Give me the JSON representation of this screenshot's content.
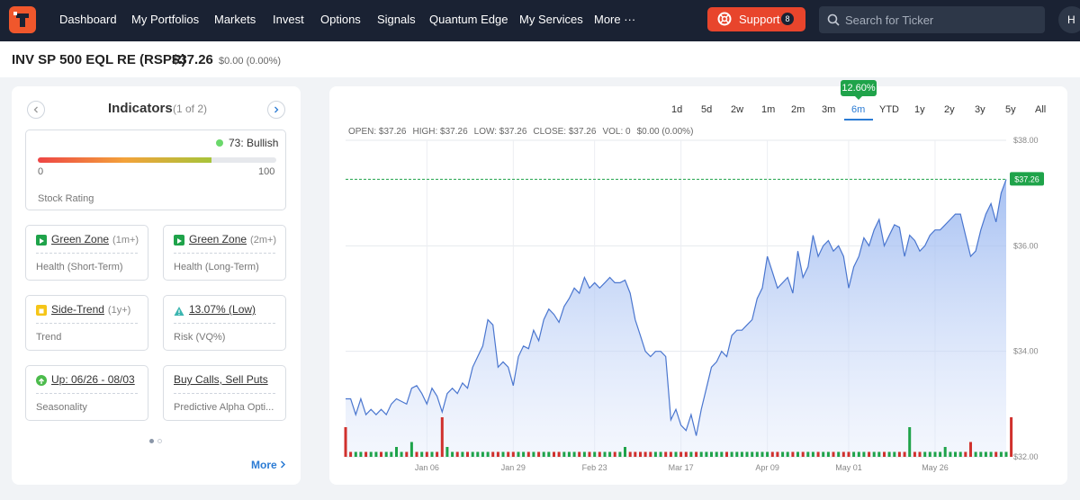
{
  "nav": {
    "items": [
      "Dashboard",
      "My Portfolios",
      "Markets",
      "Invest",
      "Options",
      "Signals",
      "Quantum Edge",
      "My Services",
      "More ···"
    ],
    "support_label": "Support",
    "support_count": "8",
    "search_placeholder": "Search for Ticker",
    "avatar_initial": "H"
  },
  "ticker": {
    "name": "INV SP 500 EQL RE (RSPR)",
    "price": "$37.26",
    "change": "$0.00 (0.00%)"
  },
  "indicators": {
    "title": "Indicators",
    "page": "(1 of 2)",
    "rating": {
      "text": "73: Bullish",
      "value": 73,
      "min_label": "0",
      "max_label": "100",
      "caption": "Stock Rating"
    },
    "cards": [
      {
        "label": "Green Zone",
        "sub": "(1m+)",
        "caption": "Health (Short-Term)",
        "icon": "play-icon",
        "color": "#1fa34a"
      },
      {
        "label": "Green Zone",
        "sub": "(2m+)",
        "caption": "Health (Long-Term)",
        "icon": "play-icon",
        "color": "#1fa34a"
      },
      {
        "label": "Side-Trend",
        "sub": "(1y+)",
        "caption": "Trend",
        "icon": "square-icon",
        "color": "#f5c518"
      },
      {
        "label": "13.07% (Low)",
        "sub": "",
        "caption": "Risk (VQ%)",
        "icon": "warning-icon",
        "color": "#3bb5b0"
      },
      {
        "label": "Up: 06/26 - 08/03",
        "sub": "",
        "caption": "Seasonality",
        "icon": "arrow-up-circle-icon",
        "color": "#4cbb4c"
      },
      {
        "label": "Buy Calls, Sell Puts",
        "sub": "",
        "caption": "Predictive Alpha Opti...",
        "icon": "",
        "color": ""
      }
    ],
    "more_label": "More"
  },
  "chart_panel": {
    "ranges": [
      "1d",
      "5d",
      "2w",
      "1m",
      "2m",
      "3m",
      "6m",
      "YTD",
      "1y",
      "2y",
      "3y",
      "5y",
      "All"
    ],
    "active_range": "6m",
    "range_change": "12.60%",
    "ohlc": {
      "open": "OPEN: $37.26",
      "high": "HIGH: $37.26",
      "low": "LOW: $37.26",
      "close": "CLOSE: $37.26",
      "vol": "VOL: 0",
      "chg": "$0.00 (0.00%)"
    },
    "last_price_tag": "$37.26"
  },
  "chart_data": {
    "type": "area",
    "y_ticks": [
      "$38.00",
      "$36.00",
      "$34.00",
      "$32.00"
    ],
    "ylim": [
      32,
      38
    ],
    "x_ticks": [
      "Jan 06",
      "Jan 29",
      "Feb 23",
      "Mar 17",
      "Apr 09",
      "May 01",
      "May 26"
    ],
    "reference_line": 37.26,
    "series": [
      {
        "values": [
          33.1,
          33.1,
          32.8,
          33.1,
          32.8,
          32.9,
          32.8,
          32.9,
          32.8,
          33.0,
          33.1,
          33.05,
          33.0,
          33.3,
          33.35,
          33.2,
          33.0,
          33.3,
          33.15,
          32.85,
          33.2,
          33.3,
          33.2,
          33.4,
          33.3,
          33.7,
          33.9,
          34.1,
          34.6,
          34.5,
          33.7,
          33.8,
          33.7,
          33.35,
          33.9,
          34.1,
          34.05,
          34.4,
          34.2,
          34.6,
          34.8,
          34.7,
          34.55,
          34.85,
          35.0,
          35.2,
          35.1,
          35.4,
          35.2,
          35.3,
          35.2,
          35.3,
          35.4,
          35.3,
          35.3,
          35.35,
          35.1,
          34.6,
          34.3,
          34.0,
          33.9,
          34.0,
          34.0,
          33.9,
          32.7,
          32.9,
          32.6,
          32.5,
          32.8,
          32.4,
          32.9,
          33.3,
          33.7,
          33.8,
          34.0,
          33.9,
          34.3,
          34.4,
          34.4,
          34.5,
          34.6,
          35.0,
          35.2,
          35.8,
          35.5,
          35.2,
          35.3,
          35.4,
          35.1,
          35.9,
          35.4,
          35.6,
          36.2,
          35.8,
          36.0,
          36.1,
          35.9,
          36.0,
          35.8,
          35.2,
          35.6,
          35.8,
          36.15,
          36.0,
          36.3,
          36.5,
          36.0,
          36.2,
          36.4,
          36.35,
          35.8,
          36.2,
          36.1,
          35.9,
          36.0,
          36.2,
          36.3,
          36.3,
          36.4,
          36.5,
          36.6,
          36.6,
          36.2,
          35.8,
          35.9,
          36.3,
          36.6,
          36.8,
          36.45,
          37.0,
          37.26
        ]
      }
    ],
    "volume": [
      6,
      1,
      1,
      1,
      1,
      1,
      1,
      1,
      1,
      1,
      2,
      1,
      1,
      3,
      1,
      1,
      1,
      1,
      1,
      8,
      2,
      1,
      1,
      1,
      1,
      1,
      1,
      1,
      1,
      1,
      1,
      1,
      1,
      1,
      1,
      1,
      1,
      1,
      1,
      1,
      1,
      1,
      1,
      1,
      1,
      1,
      1,
      1,
      1,
      1,
      1,
      1,
      1,
      1,
      1,
      2,
      1,
      1,
      1,
      1,
      1,
      1,
      1,
      1,
      1,
      1,
      1,
      1,
      1,
      1,
      1,
      1,
      1,
      1,
      1,
      1,
      1,
      1,
      1,
      1,
      1,
      1,
      1,
      1,
      1,
      1,
      1,
      1,
      1,
      1,
      1,
      1,
      1,
      1,
      1,
      1,
      1,
      1,
      1,
      1,
      1,
      1,
      1,
      1,
      1,
      1,
      1,
      1,
      1,
      1,
      1,
      6,
      1,
      1,
      1,
      1,
      1,
      1,
      2,
      1,
      1,
      1,
      1,
      3,
      1,
      1,
      1,
      1,
      1,
      1,
      1,
      8
    ],
    "volume_up": [
      false,
      false,
      true,
      true,
      false,
      true,
      true,
      false,
      true,
      true,
      true,
      true,
      false,
      true,
      false,
      true,
      false,
      true,
      false,
      false,
      true,
      true,
      false,
      true,
      false,
      true,
      true,
      true,
      true,
      false,
      false,
      true,
      false,
      false,
      true,
      true,
      false,
      true,
      false,
      true,
      true,
      false,
      false,
      true,
      true,
      true,
      false,
      true,
      false,
      true,
      false,
      true,
      true,
      false,
      true,
      true,
      false,
      false,
      false,
      false,
      false,
      true,
      true,
      false,
      false,
      true,
      false,
      false,
      true,
      false,
      true,
      true,
      true,
      true,
      true,
      false,
      true,
      true,
      true,
      true,
      true,
      true,
      true,
      true,
      false,
      false,
      true,
      true,
      false,
      true,
      false,
      true,
      true,
      false,
      true,
      true,
      false,
      true,
      false,
      false,
      true,
      true,
      true,
      false,
      true,
      true,
      false,
      true,
      true,
      false,
      false,
      true,
      false,
      false,
      true,
      true,
      true,
      true,
      true,
      true,
      true,
      true,
      false,
      false,
      true,
      true,
      true,
      true,
      false,
      true,
      true
    ]
  }
}
